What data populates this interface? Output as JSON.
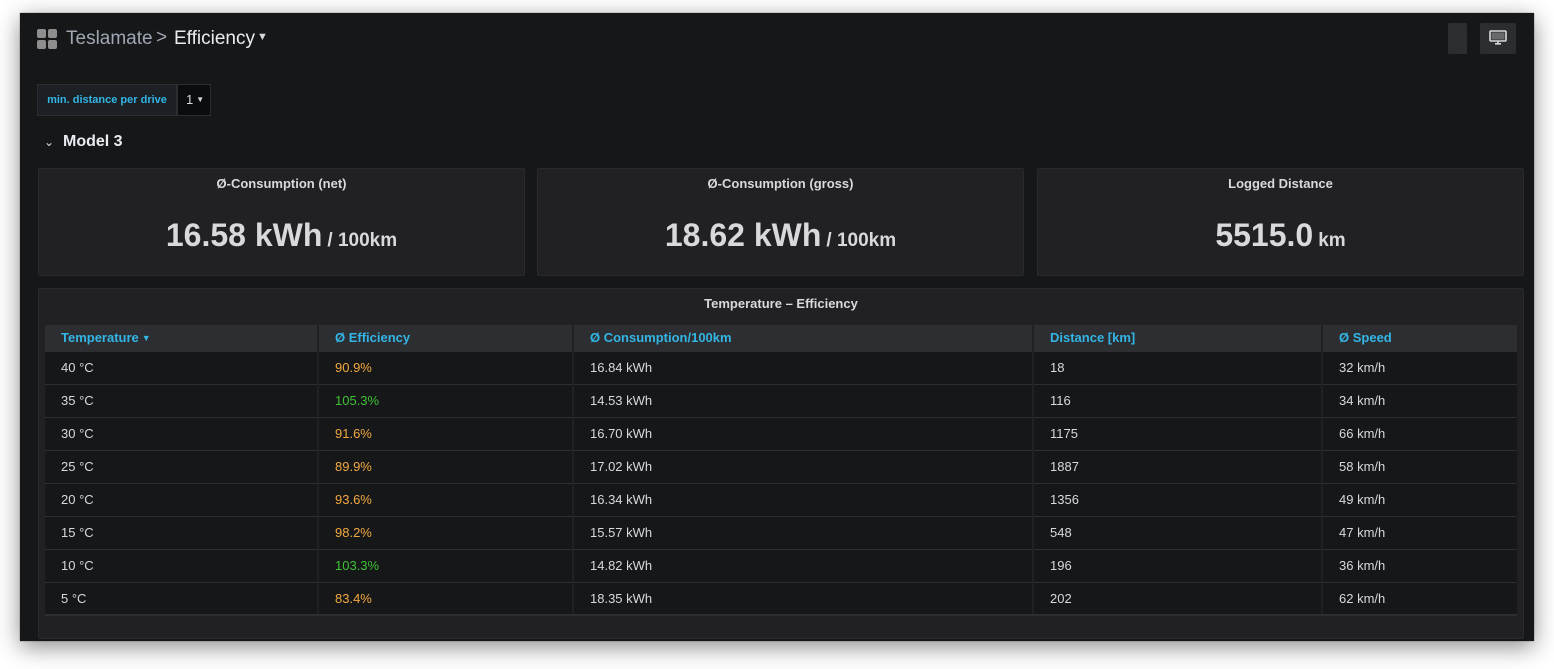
{
  "breadcrumb": {
    "folder": "Teslamate",
    "separator": ">",
    "title": "Efficiency"
  },
  "variable": {
    "label": "min. distance per drive",
    "value": "1"
  },
  "row": {
    "title": "Model 3"
  },
  "stats": [
    {
      "title": "Ø-Consumption (net)",
      "value": "16.58 kWh",
      "unit": "/ 100km"
    },
    {
      "title": "Ø-Consumption (gross)",
      "value": "18.62 kWh",
      "unit": "/ 100km"
    },
    {
      "title": "Logged Distance",
      "value": "5515.0",
      "unit": "km"
    }
  ],
  "table": {
    "title": "Temperature – Efficiency",
    "columns": [
      "Temperature",
      "Ø Efficiency",
      "Ø Consumption/100km",
      "Distance [km]",
      "Ø Speed"
    ],
    "rows": [
      {
        "temperature": "40 °C",
        "efficiency": "90.9%",
        "efficiency_color": "orange",
        "consumption": "16.84 kWh",
        "distance": "18",
        "speed": "32 km/h"
      },
      {
        "temperature": "35 °C",
        "efficiency": "105.3%",
        "efficiency_color": "green",
        "consumption": "14.53 kWh",
        "distance": "116",
        "speed": "34 km/h"
      },
      {
        "temperature": "30 °C",
        "efficiency": "91.6%",
        "efficiency_color": "orange",
        "consumption": "16.70 kWh",
        "distance": "1175",
        "speed": "66 km/h"
      },
      {
        "temperature": "25 °C",
        "efficiency": "89.9%",
        "efficiency_color": "orange",
        "consumption": "17.02 kWh",
        "distance": "1887",
        "speed": "58 km/h"
      },
      {
        "temperature": "20 °C",
        "efficiency": "93.6%",
        "efficiency_color": "orange",
        "consumption": "16.34 kWh",
        "distance": "1356",
        "speed": "49 km/h"
      },
      {
        "temperature": "15 °C",
        "efficiency": "98.2%",
        "efficiency_color": "orange",
        "consumption": "15.57 kWh",
        "distance": "548",
        "speed": "47 km/h"
      },
      {
        "temperature": "10 °C",
        "efficiency": "103.3%",
        "efficiency_color": "green",
        "consumption": "14.82 kWh",
        "distance": "196",
        "speed": "36 km/h"
      },
      {
        "temperature": "5 °C",
        "efficiency": "83.4%",
        "efficiency_color": "orange",
        "consumption": "18.35 kWh",
        "distance": "202",
        "speed": "62 km/h"
      }
    ]
  },
  "colors": {
    "background": "#161719",
    "panel": "#212124",
    "accent": "#33b5e5",
    "orange": "#f2a940",
    "green": "#3fc234"
  },
  "icons": {
    "apps": "apps-icon",
    "dropdown": "chevron-down-icon",
    "row_toggle": "chevron-down-icon",
    "tv_mode": "monitor-icon"
  }
}
